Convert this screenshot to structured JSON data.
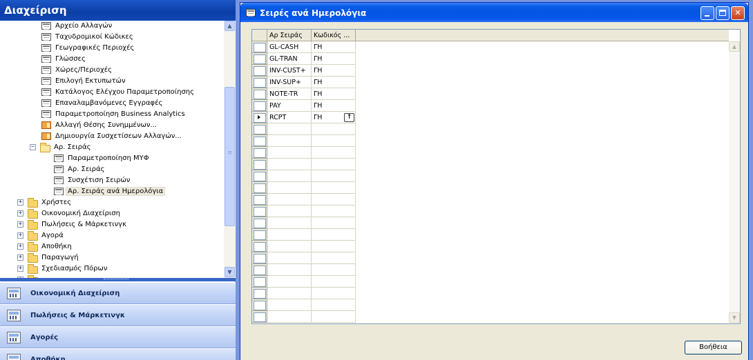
{
  "navigation_pane": {
    "title": "Διαχείριση",
    "tree": [
      {
        "label": "Αρχείο Αλλαγών",
        "icon": "form-icon",
        "level": 3
      },
      {
        "label": "Ταχυδρομικοί Κώδικες",
        "icon": "form-icon",
        "level": 3
      },
      {
        "label": "Γεωγραφικές Περιοχές",
        "icon": "form-icon",
        "level": 3
      },
      {
        "label": "Γλώσσες",
        "icon": "form-icon",
        "level": 3
      },
      {
        "label": "Χώρες/Περιοχές",
        "icon": "form-icon",
        "level": 3
      },
      {
        "label": "Επιλογή Εκτυπωτών",
        "icon": "form-icon",
        "level": 3
      },
      {
        "label": "Κατάλογος Ελέγχου Παραμετροποίησης",
        "icon": "form-icon",
        "level": 3
      },
      {
        "label": "Επαναλαμβανόμενες Εγγραφές",
        "icon": "form-icon",
        "level": 3
      },
      {
        "label": "Παραμετροποίηση Business Analytics",
        "icon": "form-icon",
        "level": 3
      },
      {
        "label": "Αλλαγή Θέσης Συνημμένων...",
        "icon": "report-icon",
        "level": 3
      },
      {
        "label": "Δημιουργία Συσχετίσεων Αλλαγών...",
        "icon": "report-icon",
        "level": 3
      },
      {
        "label": "Αρ. Σειράς",
        "icon": "folder-open-icon",
        "level": 2,
        "expander": "−"
      },
      {
        "label": "Παραμετροποίηση ΜΥΦ",
        "icon": "form-icon",
        "level": 4
      },
      {
        "label": "Αρ. Σειράς",
        "icon": "form-icon",
        "level": 4
      },
      {
        "label": "Συσχέτιση Σειρών",
        "icon": "form-icon",
        "level": 4
      },
      {
        "label": "Αρ. Σειράς ανά Ημερολόγια",
        "icon": "form-icon",
        "level": 4,
        "selected": true
      },
      {
        "label": "Χρήστες",
        "icon": "folder-icon",
        "level": 1,
        "expander": "+"
      },
      {
        "label": "Οικονομική Διαχείριση",
        "icon": "folder-icon",
        "level": 1,
        "expander": "+"
      },
      {
        "label": "Πωλήσεις & Μάρκετινγκ",
        "icon": "folder-icon",
        "level": 1,
        "expander": "+"
      },
      {
        "label": "Αγορά",
        "icon": "folder-icon",
        "level": 1,
        "expander": "+"
      },
      {
        "label": "Αποθήκη",
        "icon": "folder-icon",
        "level": 1,
        "expander": "+"
      },
      {
        "label": "Παραγωγή",
        "icon": "folder-icon",
        "level": 1,
        "expander": "+"
      },
      {
        "label": "Σχεδιασμός Πόρων",
        "icon": "folder-icon",
        "level": 1,
        "expander": "+"
      },
      {
        "label": "",
        "icon": "folder-icon",
        "level": 1,
        "expander": "+"
      }
    ],
    "buttons": [
      {
        "label": "Οικονομική Διαχείριση",
        "icon": "financial-icon"
      },
      {
        "label": "Πωλήσεις & Μάρκετινγκ",
        "icon": "sales-icon"
      },
      {
        "label": "Αγορές",
        "icon": "purchase-icon"
      },
      {
        "label": "Αποθήκη",
        "icon": "warehouse-icon"
      }
    ]
  },
  "window": {
    "title": "Σειρές ανά Ημερολόγια",
    "columns": [
      "Αρ Σειράς",
      "Κωδικός ..."
    ],
    "rows": [
      {
        "series": "GL-CASH",
        "code": "ΓΗ"
      },
      {
        "series": "GL-TRAN",
        "code": "ΓΗ"
      },
      {
        "series": "INV-CUST+",
        "code": "ΓΗ"
      },
      {
        "series": "INV-SUP+",
        "code": "ΓΗ"
      },
      {
        "series": "NOTE-TR",
        "code": "ΓΗ"
      },
      {
        "series": "PAY",
        "code": "ΓΗ"
      },
      {
        "series": "RCPT",
        "code": "ΓΗ",
        "current": true
      }
    ],
    "empty_row_count": 17,
    "help_button": "Βοήθεια"
  }
}
